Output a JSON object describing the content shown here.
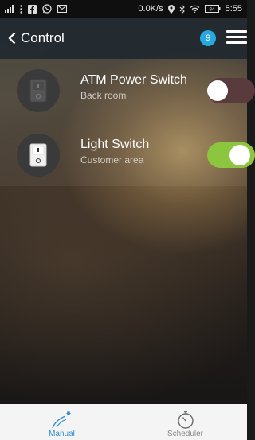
{
  "status_bar": {
    "speed": "0.0K/s",
    "battery": "84",
    "time": "5:55"
  },
  "header": {
    "title": "Control",
    "badge_count": "9"
  },
  "devices": [
    {
      "name": "ATM Power Switch",
      "location": "Back room",
      "state": "off"
    },
    {
      "name": "Light Switch",
      "location": "Customer area",
      "state": "on"
    }
  ],
  "tabs": [
    {
      "label": "Manual",
      "active": true
    },
    {
      "label": "Scheduler",
      "active": false
    }
  ],
  "colors": {
    "accent": "#27a8e0",
    "toggle_on": "#8cc63f",
    "toggle_off": "#5a3b3d",
    "active_tab": "#2f8fd6"
  }
}
